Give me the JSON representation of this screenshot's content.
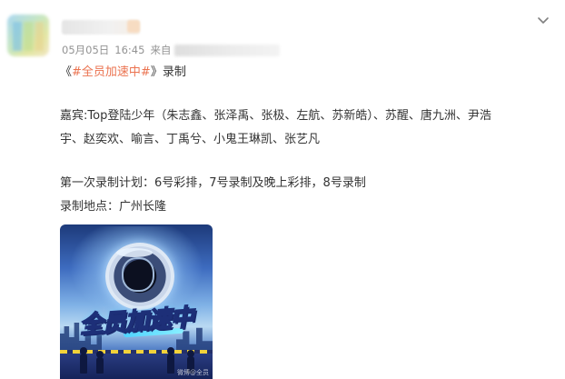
{
  "post": {
    "author": {
      "avatar_icon": "avatar-image",
      "name_blurred": true
    },
    "meta": {
      "date": "05月05日",
      "time": "16:45",
      "source_label": "来自",
      "source_blurred": true
    },
    "topic": {
      "open_bracket": "《",
      "hashtag": "#全员加速中#",
      "close_bracket": "》录制"
    },
    "lines": [
      "嘉宾:Top登陆少年（朱志鑫、张泽禹、张极、左航、苏新皓）、苏醒、唐九洲、尹浩",
      "宇、赵奕欢、喻言、丁禹兮、小鬼王琳凯、张艺凡",
      "第一次录制计划：6号彩排，7号录制及晚上彩排，8号录制",
      "录制地点：广州长隆"
    ],
    "image": {
      "poster_title": "全员加速中",
      "watermark": "微博@全员"
    }
  },
  "colors": {
    "hashtag": "#eb7350",
    "meta_text": "#939393",
    "body_text": "#333333"
  },
  "icons": {
    "menu": "chevron-down-icon"
  }
}
